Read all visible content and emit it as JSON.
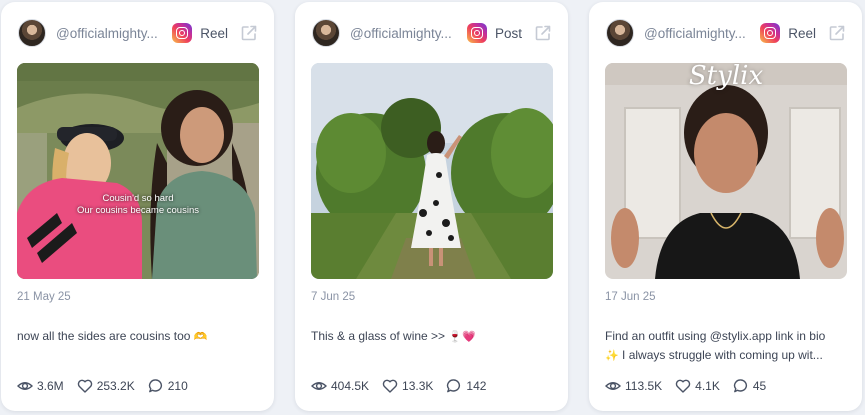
{
  "cards": [
    {
      "handle": "@officialmighty...",
      "post_type": "Reel",
      "image_caption_line1": "Cousin'd so hard",
      "image_caption_line2": "Our cousins became cousins",
      "date": "21 May 25",
      "text": "now all the sides are cousins too",
      "text_emoji": "🫶",
      "views": "3.6M",
      "likes": "253.2K",
      "comments": "210"
    },
    {
      "handle": "@officialmighty...",
      "post_type": "Post",
      "date": "7 Jun 25",
      "text": "This & a glass of wine >>",
      "text_emoji": "🍷💗",
      "views": "404.5K",
      "likes": "13.3K",
      "comments": "142"
    },
    {
      "handle": "@officialmighty...",
      "post_type": "Reel",
      "image_overlay_text": "Stylix",
      "date": "17 Jun 25",
      "text": "Find an outfit using @stylix.app link in bio",
      "text_line2": "I always struggle with coming up wit...",
      "text_emoji": "✨",
      "views": "113.5K",
      "likes": "4.1K",
      "comments": "45"
    }
  ],
  "icons": {
    "platform": "instagram-icon",
    "external": "external-link-icon",
    "views": "eye-icon",
    "likes": "heart-icon",
    "comments": "comment-icon"
  },
  "colors": {
    "background": "#eef1f6",
    "card": "#ffffff",
    "muted_text": "#8a93a5",
    "body_text": "#3d4555"
  }
}
